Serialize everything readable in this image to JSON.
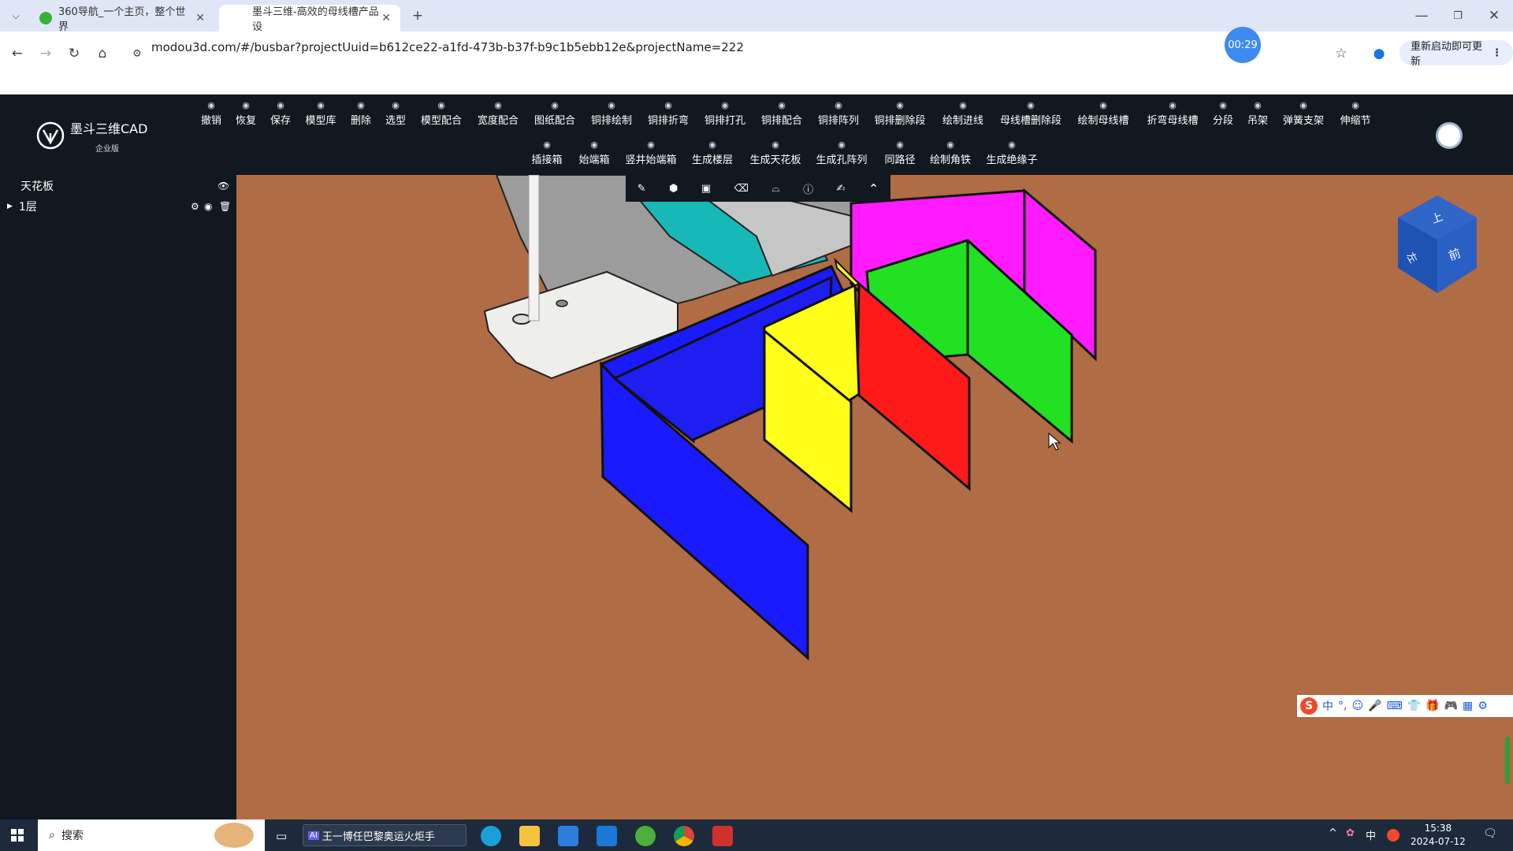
{
  "browser": {
    "tabs": [
      {
        "label": "360导航_一个主页，整个世界",
        "active": false
      },
      {
        "label": "墨斗三维-高效的母线槽产品设",
        "active": true
      }
    ],
    "url": "modou3d.com/#/busbar?projectUuid=b612ce22-a1fd-473b-b37f-b9c1b5ebb12e&projectName=222",
    "timer": "00:29",
    "relaunch_label": "重新启动即可更新"
  },
  "app": {
    "name": "墨斗三维CAD",
    "edition": "企业版",
    "toolbar_row1": [
      "撤销",
      "恢复",
      "保存",
      "模型库",
      "删除",
      "选型",
      "模型配合",
      "宽度配合",
      "图纸配合",
      "铜排绘制",
      "铜排折弯",
      "铜排打孔",
      "铜排配合",
      "铜排阵列",
      "铜排删除段",
      "绘制进线",
      "母线槽删除段",
      "绘制母线槽",
      "折弯母线槽",
      "分段",
      "吊架",
      "弹簧支架",
      "伸缩节"
    ],
    "toolbar_row2": [
      "插接箱",
      "始端箱",
      "竖井始端箱",
      "生成楼层",
      "生成天花板",
      "生成孔阵列",
      "同路径",
      "绘制角铁",
      "生成绝缘子"
    ]
  },
  "sidebar": {
    "items": [
      {
        "label": "天花板",
        "level": 0
      },
      {
        "label": "1层",
        "level": 0
      }
    ]
  },
  "viewcube": {
    "top_label": "上",
    "left_label": "左",
    "front_label": "前"
  },
  "colors": {
    "viewport_bg": "#b06c45",
    "header_bg": "#111820",
    "busbar_blue": "#1a1aff",
    "busbar_yellow": "#ffff1a",
    "busbar_red": "#ff1a1a",
    "busbar_green": "#22e022",
    "busbar_magenta": "#ff1aff",
    "tray_teal": "#16b8b8"
  },
  "taskbar": {
    "search_placeholder": "搜索",
    "ai_box_text": "王一博任巴黎奥运火炬手",
    "time": "15:38",
    "date": "2024-07-12",
    "tray_lang": "中"
  }
}
